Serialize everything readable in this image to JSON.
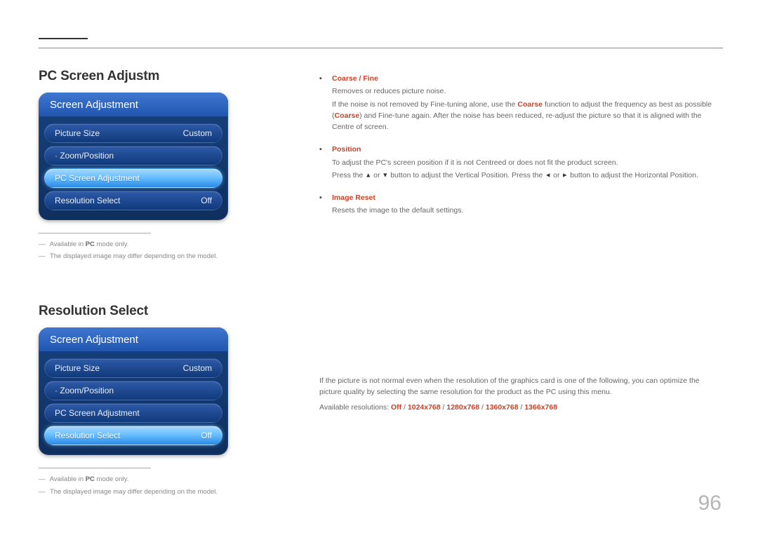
{
  "page_number": "96",
  "section1": {
    "title": "PC Screen Adjustm",
    "osd_header": "Screen Adjustment",
    "rows": [
      {
        "label": "Picture Size",
        "value": "Custom",
        "dot": false,
        "selected": false
      },
      {
        "label": "Zoom/Position",
        "value": "",
        "dot": true,
        "selected": false
      },
      {
        "label": "PC Screen Adjustment",
        "value": "",
        "dot": false,
        "selected": true
      },
      {
        "label": "Resolution Select",
        "value": "Off",
        "dot": false,
        "selected": false
      }
    ],
    "notes_prefix_a": "Available in ",
    "notes_bold_a": "PC",
    "notes_suffix_a": " mode only.",
    "notes_b": "The displayed image may differ depending on the model.",
    "bullets": [
      {
        "title": "Coarse / Fine",
        "lines": [
          "Removes or reduces picture noise.",
          "If the noise is not removed by Fine-tuning alone, use the <span class='coarse'>Coarse</span> function to adjust the frequency as best as possible (<span class='coarse'>Coarse</span>) and Fine-tune again. After the noise has been reduced, re-adjust the picture so that it is aligned with the Centre of screen."
        ]
      },
      {
        "title": "Position",
        "lines": [
          "To adjust the PC's screen position if it is not Centreed or does not fit the product screen.",
          "Press the <span class='tri'>▲</span> or <span class='tri'>▼</span> button to adjust the Vertical Position. Press the <span class='tri'>◄</span> or <span class='tri'>►</span> button to adjust the Horizontal Position."
        ]
      },
      {
        "title": "Image Reset",
        "lines": [
          "Resets the image to the default settings."
        ]
      }
    ]
  },
  "section2": {
    "title": "Resolution Select",
    "osd_header": "Screen Adjustment",
    "rows": [
      {
        "label": "Picture Size",
        "value": "Custom",
        "dot": false,
        "selected": false
      },
      {
        "label": "Zoom/Position",
        "value": "",
        "dot": true,
        "selected": false
      },
      {
        "label": "PC Screen Adjustment",
        "value": "",
        "dot": false,
        "selected": false
      },
      {
        "label": "Resolution Select",
        "value": "Off",
        "dot": false,
        "selected": true
      }
    ],
    "notes_prefix_a": "Available in ",
    "notes_bold_a": "PC",
    "notes_suffix_a": " mode only.",
    "notes_b": "The displayed image may differ depending on the model.",
    "para": "If the picture is not normal even when the resolution of the graphics card is one of the following, you can optimize the picture quality by selecting the same resolution for the product as the PC using this menu.",
    "res_prefix": "Available resolutions: ",
    "res_opts": [
      "Off",
      "1024x768",
      "1280x768",
      "1360x768",
      "1366x768"
    ]
  }
}
